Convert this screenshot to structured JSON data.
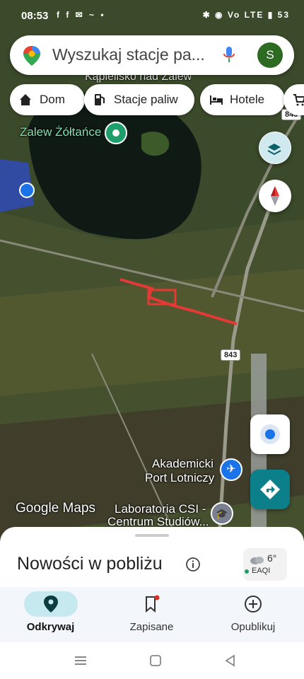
{
  "status_bar": {
    "time": "08:53",
    "left_icons": "f f ✉ ~ •",
    "right_icons": "✱ ◉ Vo LTE ▮ 53"
  },
  "search": {
    "placeholder": "Wyszukaj stacje pa...",
    "avatar_letter": "S"
  },
  "chips": [
    {
      "label": "Dom",
      "icon": "home-icon"
    },
    {
      "label": "Stacje paliw",
      "icon": "fuel-icon"
    },
    {
      "label": "Hotele",
      "icon": "bed-icon"
    }
  ],
  "map": {
    "labels": {
      "lake": "Zalew Żółtańce",
      "top_partial": "Kąpielisko nad Zalewem Żółtańce",
      "airport_line1": "Akademicki",
      "airport_line2": "Port Lotniczy",
      "lab_line1": "Laboratoria CSI -",
      "lab_line2": "Centrum Studiów...",
      "road_top": "843",
      "road_mid": "843"
    },
    "logo": "Google Maps"
  },
  "sheet": {
    "title": "Nowości w pobliżu",
    "weather": {
      "temp": "6°",
      "aqi": "EAQI"
    }
  },
  "nav": {
    "items": [
      {
        "label": "Odkrywaj",
        "icon": "explore-pin-icon",
        "active": true
      },
      {
        "label": "Zapisane",
        "icon": "bookmark-icon",
        "active": false
      },
      {
        "label": "Opublikuj",
        "icon": "add-circle-icon",
        "active": false
      }
    ]
  },
  "colors": {
    "accent_teal": "#0b7f8a",
    "nav_active_pill": "#c6e9ef",
    "route_red": "#e53935",
    "location_blue": "#1a73e8"
  }
}
